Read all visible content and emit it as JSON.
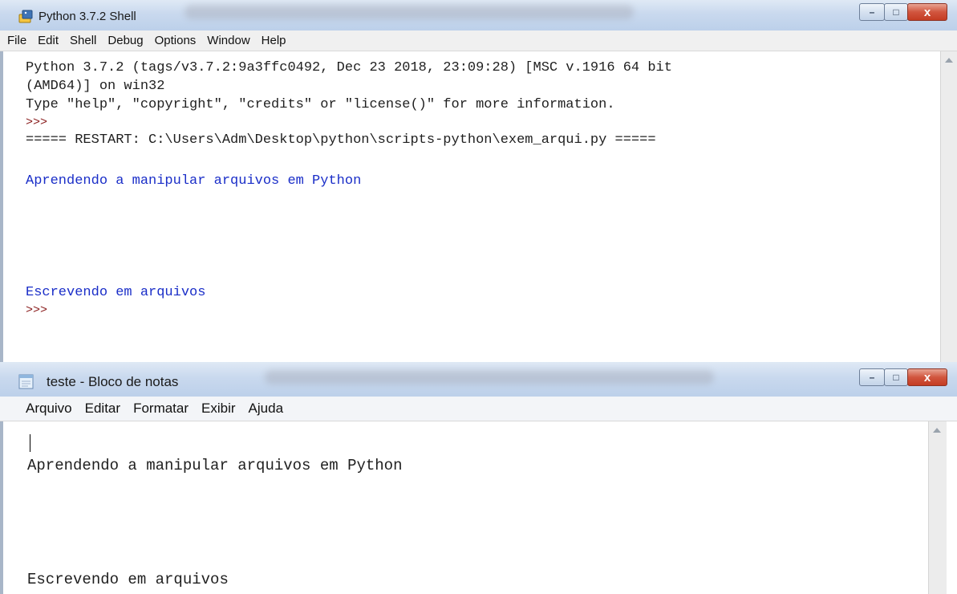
{
  "shell": {
    "title": "Python 3.7.2 Shell",
    "controls": {
      "minimize": "–",
      "maximize": "□",
      "close": "x"
    },
    "menu": [
      "File",
      "Edit",
      "Shell",
      "Debug",
      "Options",
      "Window",
      "Help"
    ],
    "lines": [
      "Python 3.7.2 (tags/v3.7.2:9a3ffc0492, Dec 23 2018, 23:09:28) [MSC v.1916 64 bit",
      "(AMD64)] on win32",
      "Type \"help\", \"copyright\", \"credits\" or \"license()\" for more information.",
      ">>>",
      "===== RESTART: C:\\Users\\Adm\\Desktop\\python\\scripts-python\\exem_arqui.py =====",
      "Aprendendo a manipular arquivos em Python",
      "Escrevendo em arquivos",
      ">>>"
    ],
    "output_color": "#1a2ec8",
    "prompt_color": "#8a1d1d"
  },
  "notepad": {
    "title": "teste - Bloco de notas",
    "controls": {
      "minimize": "–",
      "maximize": "□",
      "close": "x"
    },
    "menu": [
      "Arquivo",
      "Editar",
      "Formatar",
      "Exibir",
      "Ajuda"
    ],
    "lines": [
      "Aprendendo a manipular arquivos em Python",
      "Escrevendo em arquivos"
    ]
  },
  "colors": {
    "titlebar": "#c9d9ee",
    "close_button": "#c43c23"
  },
  "icons": [
    "python-idle-icon",
    "notepad-icon",
    "minimize-icon",
    "maximize-icon",
    "close-icon",
    "scroll-up-arrow-icon"
  ]
}
